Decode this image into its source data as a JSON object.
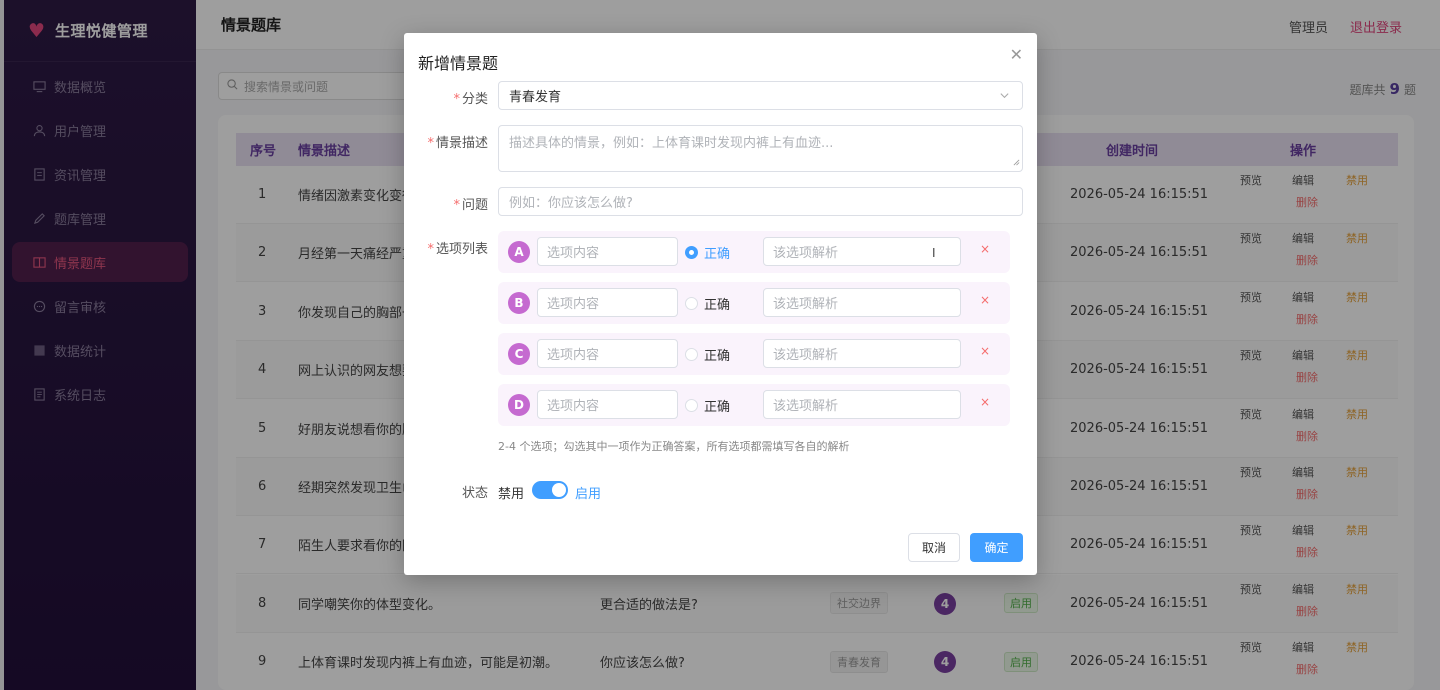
{
  "sidebar": {
    "brand": "生理悦健管理",
    "items": [
      {
        "label": "数据概览",
        "icon": "monitor-icon"
      },
      {
        "label": "用户管理",
        "icon": "user-icon"
      },
      {
        "label": "资讯管理",
        "icon": "document-icon"
      },
      {
        "label": "题库管理",
        "icon": "pen-icon"
      },
      {
        "label": "情景题库",
        "icon": "book-icon",
        "active": true
      },
      {
        "label": "留言审核",
        "icon": "chat-icon"
      },
      {
        "label": "数据统计",
        "icon": "chart-icon"
      },
      {
        "label": "系统日志",
        "icon": "log-icon"
      }
    ]
  },
  "header": {
    "title": "情景题库",
    "user": "管理员",
    "logout": "退出登录"
  },
  "toolbar": {
    "search_placeholder": "搜索情景或问题",
    "count_prefix": "题库共",
    "count": "9",
    "count_suffix": "题"
  },
  "table": {
    "headers": {
      "index": "序号",
      "desc": "情景描述",
      "created": "创建时间",
      "actions": "操作"
    },
    "rows": [
      {
        "index": "1",
        "desc": "情绪因激素变化变得",
        "question": "",
        "category": "",
        "options": "",
        "status": "",
        "created": "2026-05-24 16:15:51"
      },
      {
        "index": "2",
        "desc": "月经第一天痛经严重",
        "question": "",
        "category": "",
        "options": "",
        "status": "",
        "created": "2026-05-24 16:15:51"
      },
      {
        "index": "3",
        "desc": "你发现自己的胸部一",
        "question": "",
        "category": "",
        "options": "",
        "status": "",
        "created": "2026-05-24 16:15:51"
      },
      {
        "index": "4",
        "desc": "网上认识的网友想要",
        "question": "",
        "category": "",
        "options": "",
        "status": "",
        "created": "2026-05-24 16:15:51"
      },
      {
        "index": "5",
        "desc": "好朋友说想看你的胸",
        "question": "",
        "category": "",
        "options": "",
        "status": "",
        "created": "2026-05-24 16:15:51"
      },
      {
        "index": "6",
        "desc": "经期突然发现卫生巾",
        "question": "",
        "category": "",
        "options": "",
        "status": "",
        "created": "2026-05-24 16:15:51"
      },
      {
        "index": "7",
        "desc": "陌生人要求看你的隐",
        "question": "",
        "category": "",
        "options": "",
        "status": "",
        "created": "2026-05-24 16:15:51"
      },
      {
        "index": "8",
        "desc": "同学嘲笑你的体型变化。",
        "question": "更合适的做法是?",
        "category": "社交边界",
        "options": "4",
        "status": "启用",
        "created": "2026-05-24 16:15:51"
      },
      {
        "index": "9",
        "desc": "上体育课时发现内裤上有血迹，可能是初潮。",
        "question": "你应该怎么做?",
        "category": "青春发育",
        "options": "4",
        "status": "启用",
        "created": "2026-05-24 16:15:51"
      }
    ],
    "actions": {
      "preview": "预览",
      "edit": "编辑",
      "disable": "禁用",
      "delete": "删除"
    }
  },
  "dialog": {
    "title": "新增情景题",
    "close_icon": "close-icon",
    "fields": {
      "category_label": "分类",
      "category_value": "青春发育",
      "desc_label": "情景描述",
      "desc_placeholder": "描述具体的情景，例如：上体育课时发现内裤上有血迹...",
      "question_label": "问题",
      "question_placeholder": "例如：你应该怎么做?",
      "options_label": "选项列表",
      "status_label": "状态"
    },
    "options": [
      {
        "letter": "A",
        "content_placeholder": "选项内容",
        "correct_label": "正确",
        "correct": true,
        "analysis_placeholder": "该选项解析",
        "remove": "×"
      },
      {
        "letter": "B",
        "content_placeholder": "选项内容",
        "correct_label": "正确",
        "correct": false,
        "analysis_placeholder": "该选项解析",
        "remove": "×"
      },
      {
        "letter": "C",
        "content_placeholder": "选项内容",
        "correct_label": "正确",
        "correct": false,
        "analysis_placeholder": "该选项解析",
        "remove": "×"
      },
      {
        "letter": "D",
        "content_placeholder": "选项内容",
        "correct_label": "正确",
        "correct": false,
        "analysis_placeholder": "该选项解析",
        "remove": "×"
      }
    ],
    "hint": "2-4 个选项；勾选其中一项作为正确答案，所有选项都需填写各自的解析",
    "status_off": "禁用",
    "status_on": "启用",
    "cancel": "取消",
    "confirm": "确定"
  },
  "colors": {
    "sidebar_bg": "#2e1a45",
    "accent_pink": "#e0467c",
    "accent_purple": "#6a3fa0",
    "primary_blue": "#409eff",
    "danger_red": "#f56c6c"
  }
}
